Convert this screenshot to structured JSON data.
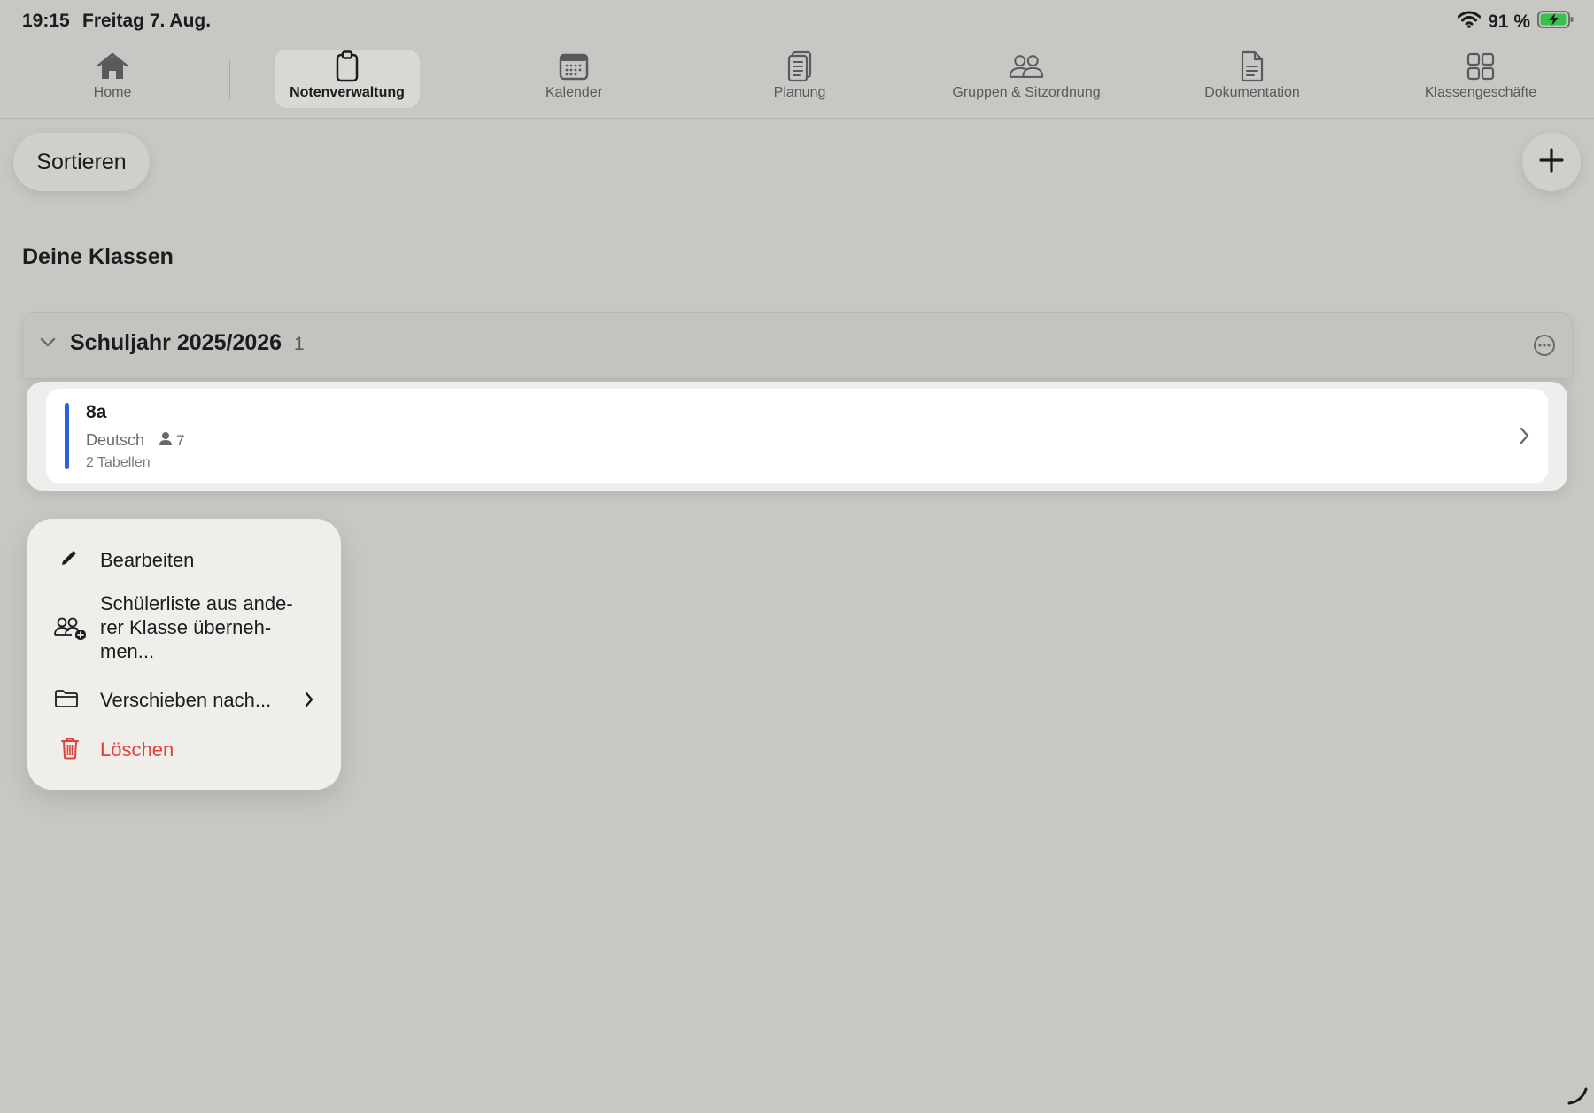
{
  "status_bar": {
    "time": "19:15",
    "date": "Freitag 7. Aug.",
    "battery": "91 %"
  },
  "tabs": [
    {
      "label": "Home",
      "icon": "house-icon",
      "active": false
    },
    {
      "label": "Notenverwaltung",
      "icon": "clipboard-icon",
      "active": true
    },
    {
      "label": "Kalender",
      "icon": "calendar-icon",
      "active": false
    },
    {
      "label": "Planung",
      "icon": "document-stack-icon",
      "active": false
    },
    {
      "label": "Gruppen & Sitzordnung",
      "icon": "people-icon",
      "active": false
    },
    {
      "label": "Dokumentation",
      "icon": "document-icon",
      "active": false
    },
    {
      "label": "Klassengeschäfte",
      "icon": "grid-icon",
      "active": false
    }
  ],
  "toolbar": {
    "sort_label": "Sortieren",
    "add_icon": "plus-icon"
  },
  "section_title": "Deine Klassen",
  "group": {
    "title": "Schuljahr 2025/2026",
    "count": "1"
  },
  "class_card": {
    "name": "8a",
    "subject": "Deutsch",
    "students": "7",
    "tables": "2 Tabellen",
    "accent_color": "#2c63d6"
  },
  "context_menu": {
    "edit": "Bearbeiten",
    "import_line1": "Schülerliste aus ande-",
    "import_line2": "rer Klasse überneh-",
    "import_line3": "men...",
    "move": "Verschieben nach...",
    "delete": "Löschen",
    "danger_color": "#e0403a"
  }
}
